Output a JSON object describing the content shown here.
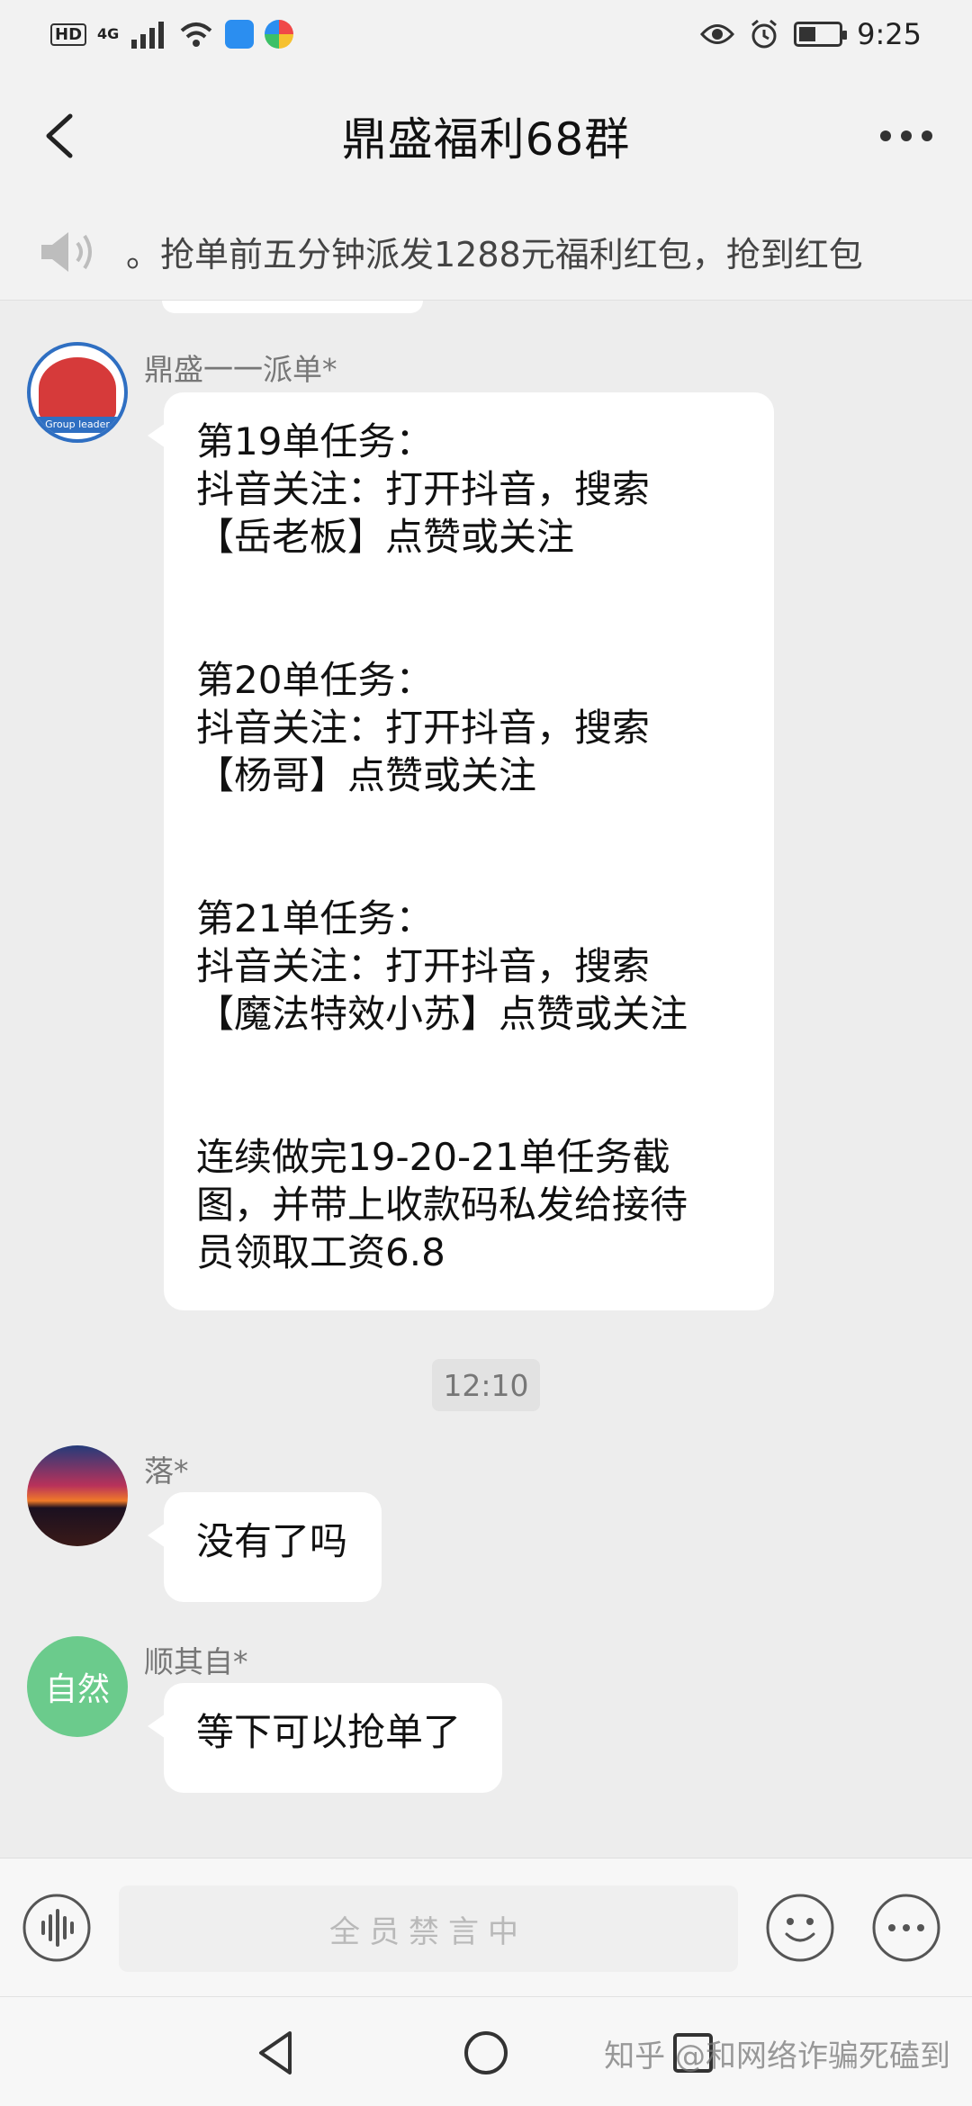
{
  "status_bar": {
    "hd": "HD",
    "network": "4G",
    "time": "9:25"
  },
  "header": {
    "title": "鼎盛福利68群",
    "back_icon": "chevron-left-icon",
    "more_icon": "more-horizontal-icon"
  },
  "notice": {
    "icon": "speaker-icon",
    "text": "。抢单前五分钟派发1288元福利红包，抢到红包"
  },
  "messages": [
    {
      "sender": "鼎盛一一派单*",
      "avatar_label": "Group leader",
      "text": "第19单任务：\n抖音关注：打开抖音，搜索\n【岳老板】点赞或关注\n\n\n第20单任务：\n抖音关注：打开抖音，搜索\n【杨哥】点赞或关注\n\n\n第21单任务：\n抖音关注：打开抖音，搜索\n【魔法特效小苏】点赞或关注\n\n\n连续做完19-20-21单任务截\n图，并带上收款码私发给接待\n员领取工资6.8"
    },
    {
      "sender": "落*",
      "text": "没有了吗"
    },
    {
      "sender": "顺其自*",
      "avatar_text": "自然",
      "text": "等下可以抢单了"
    }
  ],
  "timestamp": "12:10",
  "input_bar": {
    "placeholder": "全员禁言中",
    "voice_icon": "voice-wave-icon",
    "emoji_icon": "smiley-icon",
    "more_icon": "more-circle-icon"
  },
  "nav_bar": {
    "back_icon": "nav-back-triangle-icon",
    "home_icon": "nav-home-circle-icon",
    "recent_icon": "nav-recent-square-icon",
    "watermark": "知乎 @和网络诈骗死磕到"
  }
}
